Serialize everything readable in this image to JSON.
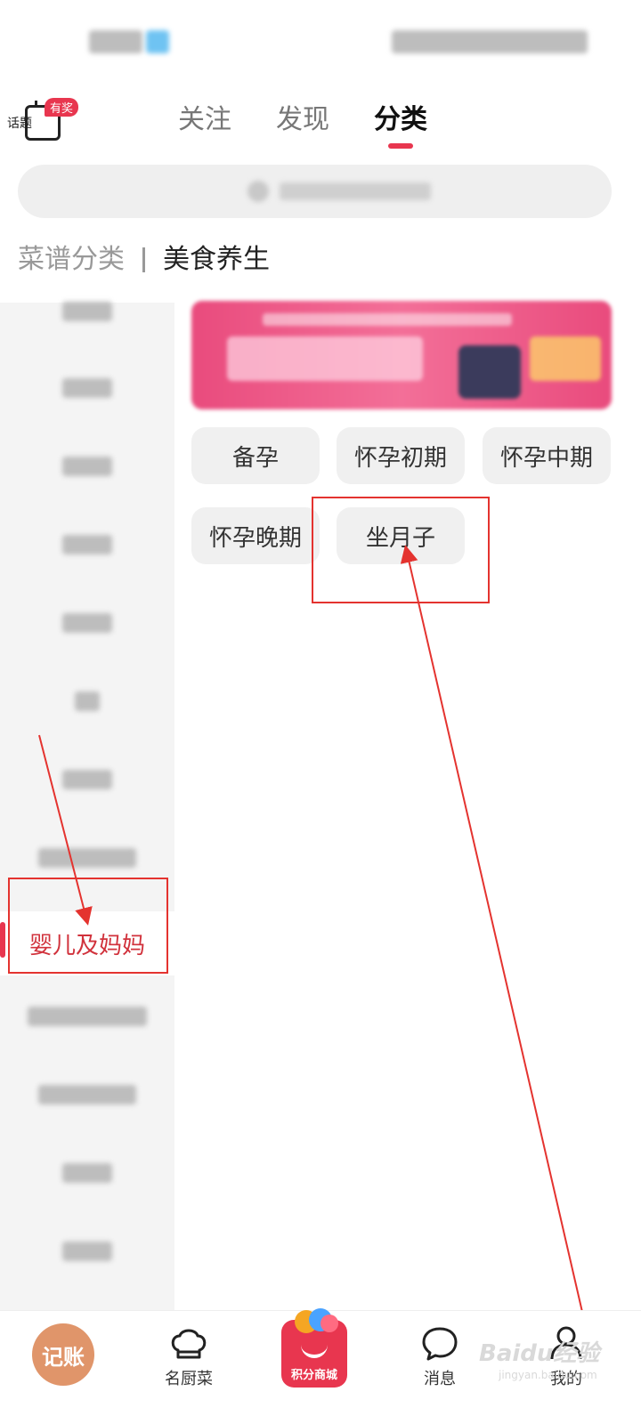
{
  "header": {
    "topic_label": "话题",
    "topic_reward": "有奖",
    "tabs": [
      {
        "label": "关注",
        "active": false
      },
      {
        "label": "发现",
        "active": false
      },
      {
        "label": "分类",
        "active": true
      }
    ]
  },
  "breadcrumb": {
    "root": "菜谱分类",
    "current": "美食养生"
  },
  "sidebar": {
    "active_item": "婴儿及妈妈"
  },
  "chips": [
    "备孕",
    "怀孕初期",
    "怀孕中期",
    "怀孕晚期",
    "坐月子"
  ],
  "bottom_nav": {
    "jizhang": "记账",
    "chef": "名厨菜",
    "mall": "积分商城",
    "messages": "消息",
    "mine": "我的"
  },
  "watermark": {
    "brand": "Baidu经验",
    "url": "jingyan.baidu.com"
  },
  "colors": {
    "accent": "#e8364f",
    "active_text": "#d1323c",
    "annotation": "#e4332f"
  }
}
